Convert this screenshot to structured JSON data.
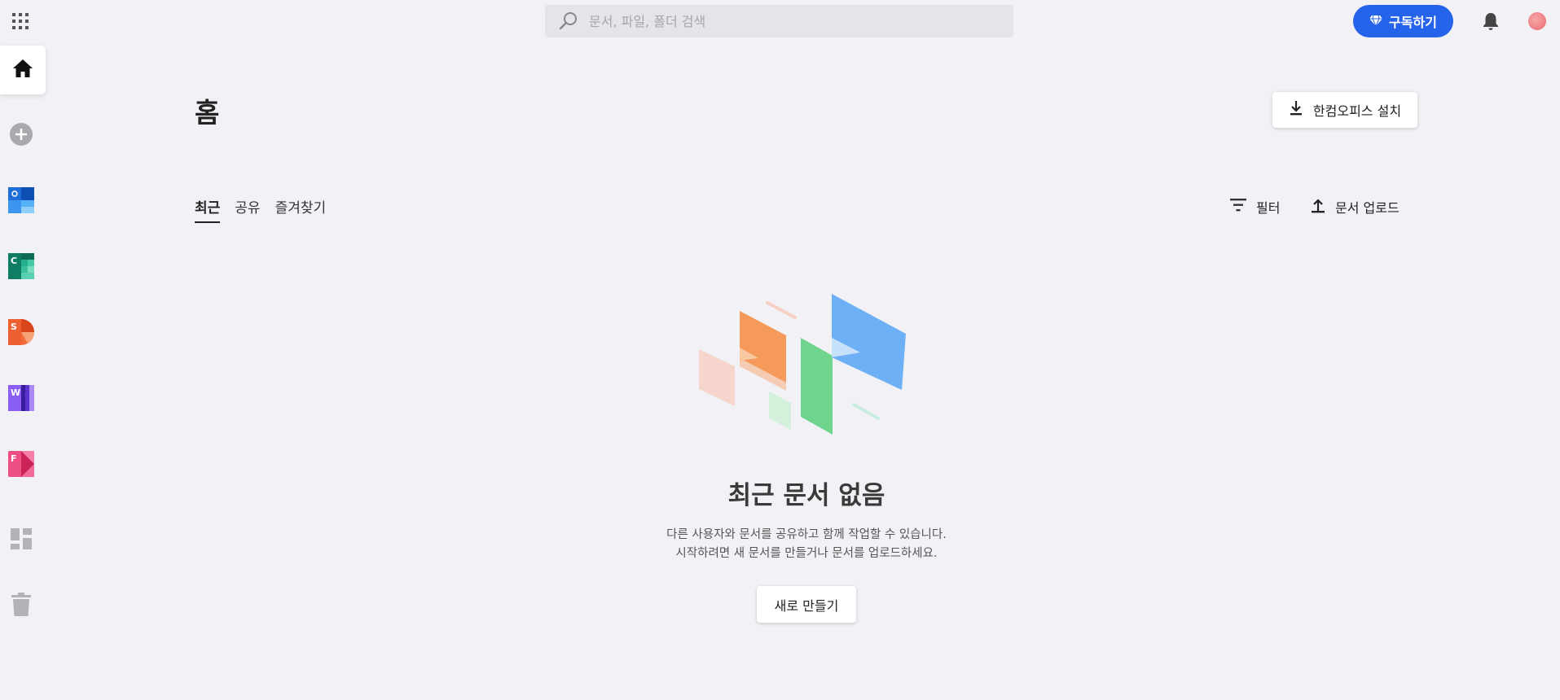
{
  "search": {
    "placeholder": "문서, 파일, 폴더 검색"
  },
  "header": {
    "subscribe_label": "구독하기"
  },
  "sidebar": {
    "items": [
      {
        "name": "home",
        "icon": "home-icon"
      },
      {
        "name": "new",
        "icon": "plus-circle-icon"
      },
      {
        "name": "hancell-calendar",
        "letter": "",
        "colors": [
          "#1a73e8",
          "#4aa3f5"
        ]
      },
      {
        "name": "hancell",
        "letter": "C",
        "colors": [
          "#0e8a70",
          "#3fcaa4"
        ]
      },
      {
        "name": "hanshow",
        "letter": "S",
        "colors": [
          "#f06432",
          "#f7a06b"
        ]
      },
      {
        "name": "hanword",
        "letter": "W",
        "colors": [
          "#6a3de8",
          "#9b7af2"
        ]
      },
      {
        "name": "hanform",
        "letter": "F",
        "colors": [
          "#e8396e",
          "#f27a9f"
        ]
      },
      {
        "name": "dashboard",
        "icon": "dashboard-icon"
      },
      {
        "name": "trash",
        "icon": "trash-icon"
      }
    ]
  },
  "main": {
    "title": "홈",
    "install_label": "한컴오피스 설치",
    "tabs": [
      {
        "label": "최근",
        "active": true
      },
      {
        "label": "공유",
        "active": false
      },
      {
        "label": "즐겨찾기",
        "active": false
      }
    ],
    "filter_label": "필터",
    "upload_label": "문서 업로드",
    "empty": {
      "title": "최근 문서 없음",
      "desc_line1": "다른 사용자와 문서를 공유하고 함께 작업할 수 있습니다.",
      "desc_line2": "시작하려면 새 문서를 만들거나 문서를 업로드하세요.",
      "new_label": "새로 만들기"
    }
  },
  "colors": {
    "accent": "#2663eb",
    "background": "#f2f1f6"
  }
}
